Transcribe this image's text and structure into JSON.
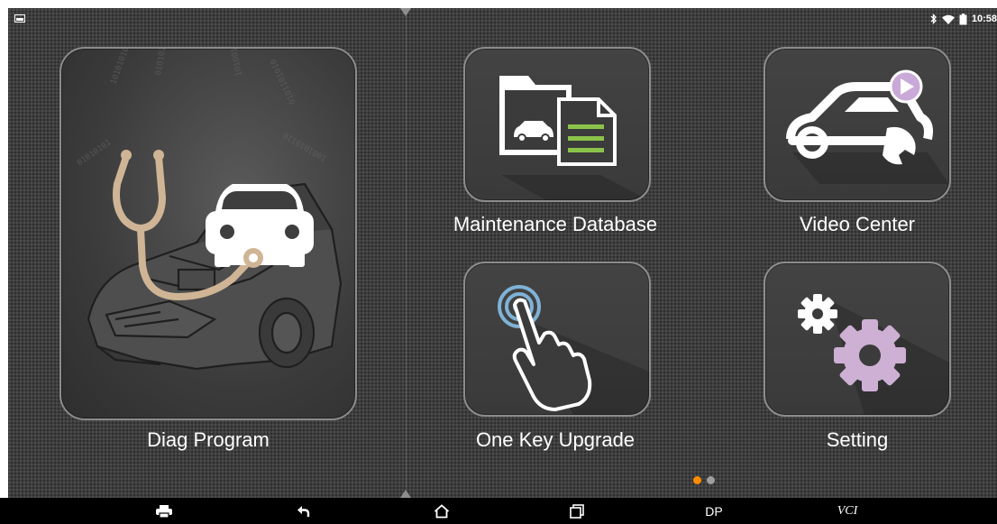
{
  "status": {
    "time": "10:58",
    "icons": [
      "notification-image-icon",
      "bluetooth-icon",
      "wifi-icon",
      "battery-icon"
    ]
  },
  "tiles": {
    "diag": {
      "label": "Diag Program",
      "icon": "stethoscope-car-icon"
    },
    "maintenance": {
      "label": "Maintenance Database",
      "icon": "folder-document-icon"
    },
    "video": {
      "label": "Video Center",
      "icon": "car-wrench-play-icon"
    },
    "upgrade": {
      "label": "One Key Upgrade",
      "icon": "tap-hand-icon"
    },
    "setting": {
      "label": "Setting",
      "icon": "gears-icon"
    }
  },
  "pager": {
    "active": 1,
    "total": 2
  },
  "navbar": {
    "print_icon": "printer-icon",
    "back_icon": "back-arrow-icon",
    "home_icon": "home-icon",
    "recent_icon": "recent-apps-icon",
    "dp_label": "DP",
    "vci_label": "VCI"
  },
  "colors": {
    "screen_bg": "#3e3e3e",
    "tile_border": "#8c8c8c",
    "accent_orange": "#ff8c00",
    "dot_inactive": "#9e9e9e",
    "stethoscope": "#cfb595",
    "gear_lilac": "#cdb0d4",
    "play_lilac": "#c9a9d8",
    "sheet_green": "#8bc34a",
    "nav_bg": "#000000"
  }
}
